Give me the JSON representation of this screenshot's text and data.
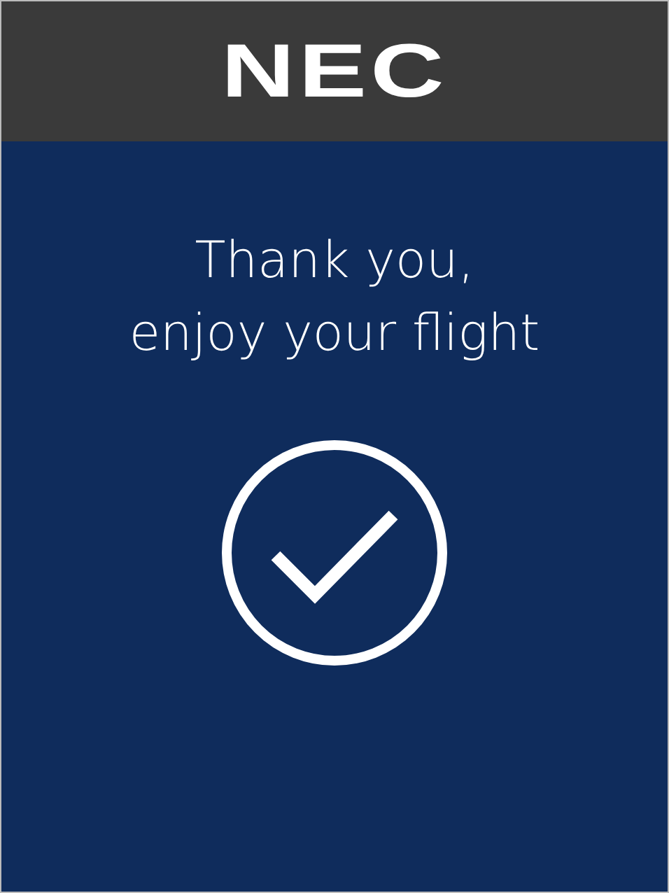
{
  "header": {
    "logo": "NEC"
  },
  "message": "Thank you,\nenjoy your flight"
}
